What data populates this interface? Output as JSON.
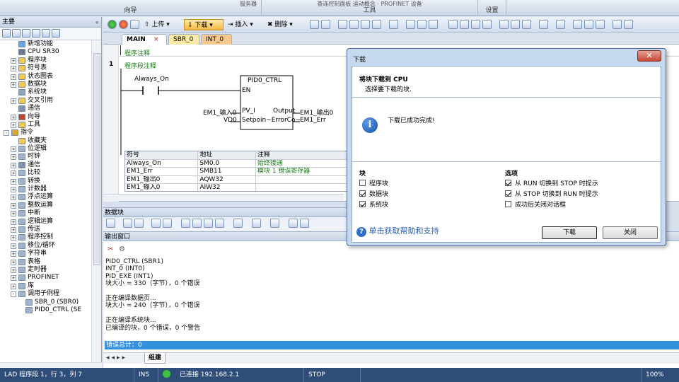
{
  "ribbon": {
    "groups": [
      "向导",
      "工具",
      "设置"
    ],
    "top_fragments": [
      "服务器",
      "查连控制面板 运动概念 · PROFINET 设备"
    ]
  },
  "left_panel": {
    "title": "主要",
    "tree": [
      {
        "label": "新增功能",
        "depth": 2,
        "expander": "",
        "icon": "help-icon"
      },
      {
        "label": "CPU SR30",
        "depth": 2,
        "expander": "",
        "icon": "cpu-icon"
      },
      {
        "label": "程序块",
        "depth": 2,
        "expander": "+",
        "icon": "folder-icon"
      },
      {
        "label": "符号表",
        "depth": 2,
        "expander": "+",
        "icon": "folder-icon"
      },
      {
        "label": "状态图表",
        "depth": 2,
        "expander": "+",
        "icon": "folder-icon"
      },
      {
        "label": "数据块",
        "depth": 2,
        "expander": "+",
        "icon": "folder-icon"
      },
      {
        "label": "系统块",
        "depth": 2,
        "expander": "",
        "icon": "system-block-icon"
      },
      {
        "label": "交叉引用",
        "depth": 2,
        "expander": "+",
        "icon": "folder-icon"
      },
      {
        "label": "通信",
        "depth": 2,
        "expander": "",
        "icon": "communication-icon"
      },
      {
        "label": "向导",
        "depth": 2,
        "expander": "+",
        "icon": "wizard-icon"
      },
      {
        "label": "工具",
        "depth": 2,
        "expander": "+",
        "icon": "folder-icon"
      },
      {
        "label": "指令",
        "depth": 1,
        "expander": "-",
        "icon": "instructions-icon"
      },
      {
        "label": "收藏夹",
        "depth": 2,
        "expander": "",
        "icon": "favorites-icon"
      },
      {
        "label": "位逻辑",
        "depth": 2,
        "expander": "+",
        "icon": "bit-logic-icon"
      },
      {
        "label": "时钟",
        "depth": 2,
        "expander": "+",
        "icon": "clock-icon"
      },
      {
        "label": "通信",
        "depth": 2,
        "expander": "+",
        "icon": "communication-icon"
      },
      {
        "label": "比较",
        "depth": 2,
        "expander": "+",
        "icon": "compare-icon"
      },
      {
        "label": "转换",
        "depth": 2,
        "expander": "+",
        "icon": "convert-icon"
      },
      {
        "label": "计数器",
        "depth": 2,
        "expander": "+",
        "icon": "counter-icon"
      },
      {
        "label": "浮点运算",
        "depth": 2,
        "expander": "+",
        "icon": "float-math-icon"
      },
      {
        "label": "整数运算",
        "depth": 2,
        "expander": "+",
        "icon": "integer-math-icon"
      },
      {
        "label": "中断",
        "depth": 2,
        "expander": "+",
        "icon": "interrupt-icon"
      },
      {
        "label": "逻辑运算",
        "depth": 2,
        "expander": "+",
        "icon": "logic-icon"
      },
      {
        "label": "传送",
        "depth": 2,
        "expander": "+",
        "icon": "move-icon"
      },
      {
        "label": "程序控制",
        "depth": 2,
        "expander": "+",
        "icon": "program-control-icon"
      },
      {
        "label": "移位/循环",
        "depth": 2,
        "expander": "+",
        "icon": "shift-icon"
      },
      {
        "label": "字符串",
        "depth": 2,
        "expander": "+",
        "icon": "string-icon"
      },
      {
        "label": "表格",
        "depth": 2,
        "expander": "+",
        "icon": "table-icon"
      },
      {
        "label": "定时器",
        "depth": 2,
        "expander": "+",
        "icon": "timer-icon"
      },
      {
        "label": "PROFINET",
        "depth": 2,
        "expander": "+",
        "icon": "profinet-icon"
      },
      {
        "label": "库",
        "depth": 2,
        "expander": "+",
        "icon": "library-icon"
      },
      {
        "label": "调用子例程",
        "depth": 2,
        "expander": "-",
        "icon": "subroutine-folder-icon"
      },
      {
        "label": "SBR_0 (SBR0)",
        "depth": 3,
        "expander": "",
        "icon": "subroutine-icon"
      },
      {
        "label": "PID0_CTRL (SE",
        "depth": 3,
        "expander": "",
        "icon": "subroutine-icon"
      }
    ]
  },
  "toolbar": {
    "upload_label": "上传",
    "download_label": "下载",
    "insert_label": "插入",
    "delete_label": "删除"
  },
  "editor": {
    "tabs": [
      {
        "label": "MAIN",
        "closable": "×"
      },
      {
        "label": "SBR_0",
        "closable": ""
      },
      {
        "label": "INT_0",
        "closable": ""
      }
    ],
    "program_comment": "程序注释",
    "network_number": "1",
    "network_comment": "程序段注释",
    "contact_label": "Always_On",
    "block_name": "PID0_CTRL",
    "en_label": "EN",
    "pv_label": "PV_I",
    "output_label": "Output",
    "setpoint_label": "Setpoin~ErrorCo~",
    "pv_input": "EM1_输入0",
    "output_signal": "EM1_输出0",
    "vd_input": "VD0",
    "err_signal": "EM1_Err",
    "symbol_table": {
      "headers": [
        "符号",
        "地址",
        "注释"
      ],
      "rows": [
        [
          "Always_On",
          "SM0.0",
          "始终接通"
        ],
        [
          "EM1_Err",
          "SMB11",
          "模块 1 错误寄存器"
        ],
        [
          "EM1_输出0",
          "AQW32",
          ""
        ],
        [
          "EM1_输入0",
          "AIW32",
          ""
        ]
      ]
    }
  },
  "data_block_panel": {
    "title": "数据块"
  },
  "output_window": {
    "title": "输出窗口",
    "lines": [
      "PID0_CTRL (SBR1)",
      "INT_0 (INT0)",
      "PID_EXE (INT1)",
      "块大小 = 330（字节），0 个错误",
      "",
      "正在编译数据页...",
      "块大小 = 240（字节），0 个错误",
      "",
      "正在编译系统块...",
      "已编译的块，0 个错误，0 个警告"
    ],
    "error_total": "错误总计：0",
    "bottom_tab": "组建"
  },
  "status_bar": {
    "position": "LAD 程序段 1，行 3，列 7",
    "mode": "INS",
    "connection": "已连接 192.168.2.1",
    "state": "STOP",
    "zoom": "100%"
  },
  "dialog": {
    "title": "下载",
    "heading": "将块下载到 CPU",
    "subheading": "选择要下载的块.",
    "message": "下载已成功完成!",
    "blocks_title": "块",
    "blocks": [
      {
        "label": "程序块",
        "checked": false
      },
      {
        "label": "数据块",
        "checked": true
      },
      {
        "label": "系统块",
        "checked": true
      }
    ],
    "options_title": "选项",
    "options": [
      {
        "label": "从 RUN 切换到 STOP 时提示",
        "checked": true
      },
      {
        "label": "从 STOP 切换到 RUN 时提示",
        "checked": true
      },
      {
        "label": "成功后关闭对话框",
        "checked": false
      }
    ],
    "help_text": "单击获取帮助和支持",
    "download_button": "下载",
    "close_button": "关闭",
    "close_icon": "✕"
  }
}
